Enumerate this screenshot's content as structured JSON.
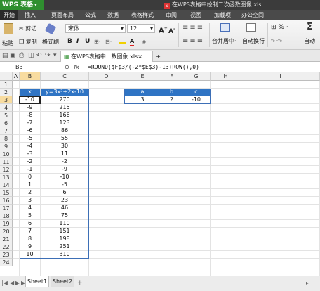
{
  "app": {
    "button_label": "WPS 表格",
    "caret": "▾",
    "document_title": "在WPS表格中绘制二次函数图像.xls"
  },
  "menu": [
    {
      "label": "开始"
    },
    {
      "label": "插入"
    },
    {
      "label": "页面布局"
    },
    {
      "label": "公式"
    },
    {
      "label": "数据"
    },
    {
      "label": "表格样式"
    },
    {
      "label": "审阅"
    },
    {
      "label": "视图"
    },
    {
      "label": "加载项"
    },
    {
      "label": "办公空间"
    }
  ],
  "ribbon": {
    "paste": "粘贴",
    "cut": "剪切",
    "copy": "复制",
    "format_painter": "格式刷",
    "font_name": "宋体",
    "font_size": "12",
    "grow_font": "A",
    "shrink_font": "A",
    "bold": "B",
    "italic": "I",
    "underline": "U",
    "merge_center": "合并居中",
    "wrap_text": "自动换行",
    "percent": "%",
    "auto": "自动"
  },
  "tabs": {
    "doc_tab": "在WPS表格中...数图象.xls",
    "close": "×",
    "new": "+"
  },
  "formula_bar": {
    "name_box": "B3",
    "fx": "fx",
    "formula": "=ROUND($F$3/(-2*$E$3)-13+ROW(),0)"
  },
  "grid": {
    "columns": [
      "A",
      "B",
      "C",
      "D",
      "E",
      "F",
      "G",
      "H",
      "I"
    ],
    "rows": [
      "1",
      "2",
      "3",
      "4",
      "5",
      "6",
      "7",
      "8",
      "9",
      "10",
      "11",
      "12",
      "13",
      "14",
      "15",
      "16",
      "17",
      "18",
      "19",
      "20",
      "21",
      "22",
      "23",
      "24"
    ],
    "table1_headers": [
      "x",
      "y=3x²+2x-10"
    ],
    "table1_rows": [
      [
        "-10",
        "270"
      ],
      [
        "-9",
        "215"
      ],
      [
        "-8",
        "166"
      ],
      [
        "-7",
        "123"
      ],
      [
        "-6",
        "86"
      ],
      [
        "-5",
        "55"
      ],
      [
        "-4",
        "30"
      ],
      [
        "-3",
        "11"
      ],
      [
        "-2",
        "-2"
      ],
      [
        "-1",
        "-9"
      ],
      [
        "0",
        "-10"
      ],
      [
        "1",
        "-5"
      ],
      [
        "2",
        "6"
      ],
      [
        "3",
        "23"
      ],
      [
        "4",
        "46"
      ],
      [
        "5",
        "75"
      ],
      [
        "6",
        "110"
      ],
      [
        "7",
        "151"
      ],
      [
        "8",
        "198"
      ],
      [
        "9",
        "251"
      ],
      [
        "10",
        "310"
      ]
    ],
    "table2_headers": [
      "a",
      "b",
      "c"
    ],
    "table2_values": [
      "3",
      "2",
      "-10"
    ]
  },
  "sheets": {
    "nav": [
      "|◀",
      "◀",
      "▶",
      "▶|"
    ],
    "tabs": [
      "Sheet1",
      "Sheet2"
    ],
    "add": "+"
  },
  "colors": {
    "header_fill": "#2f74c4",
    "selected_header": "#f8dca0",
    "app_green": "#2f8f2f"
  }
}
